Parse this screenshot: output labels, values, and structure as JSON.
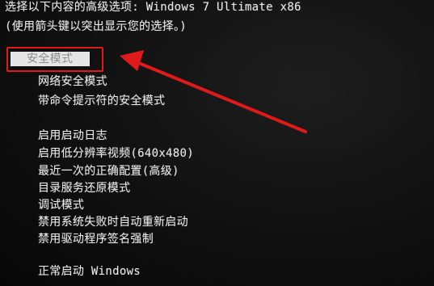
{
  "header": {
    "title": "选择以下内容的高级选项: Windows 7 Ultimate x86",
    "hint": "(使用箭头键以突出显示您的选择。)"
  },
  "menu": {
    "items": [
      {
        "label": "安全模式",
        "selected": true
      },
      {
        "label": "网络安全模式",
        "selected": false
      },
      {
        "label": "带命令提示符的安全模式",
        "selected": false
      },
      {
        "label": "启用启动日志",
        "selected": false
      },
      {
        "label": "启用低分辨率视频(640x480)",
        "selected": false
      },
      {
        "label": "最近一次的正确配置(高级)",
        "selected": false
      },
      {
        "label": "目录服务还原模式",
        "selected": false
      },
      {
        "label": "调试模式",
        "selected": false
      },
      {
        "label": "禁用系统失败时自动重新启动",
        "selected": false
      },
      {
        "label": "禁用驱动程序签名强制",
        "selected": false
      },
      {
        "label": "正常启动 Windows",
        "selected": false
      }
    ]
  },
  "annotation": {
    "box_color": "#e01a1a",
    "arrow_color": "#e01a1a"
  },
  "colors": {
    "background": "#0c0c0c",
    "text": "#e8e8e8",
    "selection_bg": "#e6e6e6",
    "selection_text": "#8c8c8c"
  }
}
